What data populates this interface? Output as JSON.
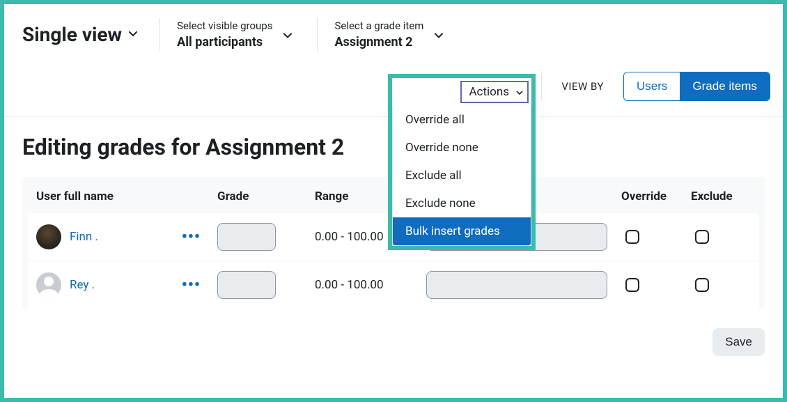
{
  "header": {
    "title": "Single view",
    "group_selector": {
      "label": "Select visible groups",
      "value": "All participants"
    },
    "item_selector": {
      "label": "Select a grade item",
      "value": "Assignment 2"
    }
  },
  "toolbar": {
    "actions_label": "Actions",
    "actions_menu": [
      "Override all",
      "Override none",
      "Exclude all",
      "Exclude none",
      "Bulk insert grades"
    ],
    "actions_selected_index": 4,
    "viewby_label": "VIEW BY",
    "viewby_options": [
      "Users",
      "Grade items"
    ],
    "viewby_active_index": 1
  },
  "page": {
    "heading": "Editing grades for Assignment 2"
  },
  "table": {
    "columns": {
      "user": "User full name",
      "grade": "Grade",
      "range": "Range",
      "feedback": "",
      "override": "Override",
      "exclude": "Exclude"
    },
    "rows": [
      {
        "name": "Finn .",
        "avatar": "finn",
        "grade": "",
        "range": "0.00 - 100.00",
        "feedback": "",
        "override": false,
        "exclude": false
      },
      {
        "name": "Rey .",
        "avatar": "blank",
        "grade": "",
        "range": "0.00 - 100.00",
        "feedback": "",
        "override": false,
        "exclude": false
      }
    ]
  },
  "footer": {
    "save_label": "Save"
  }
}
